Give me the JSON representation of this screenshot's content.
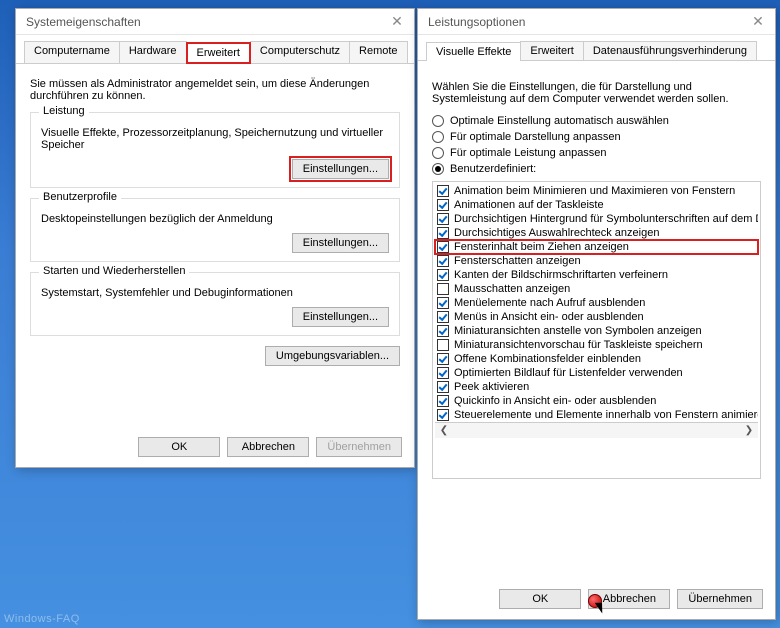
{
  "left": {
    "title": "Systemeigenschaften",
    "tabs": [
      "Computername",
      "Hardware",
      "Erweitert",
      "Computerschutz",
      "Remote"
    ],
    "active_tab": 2,
    "hint": "Sie müssen als Administrator angemeldet sein, um diese Änderungen durchführen zu können.",
    "groups": {
      "leistung": {
        "title": "Leistung",
        "desc": "Visuelle Effekte, Prozessorzeitplanung, Speichernutzung und virtueller Speicher",
        "btn": "Einstellungen..."
      },
      "profile": {
        "title": "Benutzerprofile",
        "desc": "Desktopeinstellungen bezüglich der Anmeldung",
        "btn": "Einstellungen..."
      },
      "start": {
        "title": "Starten und Wiederherstellen",
        "desc": "Systemstart, Systemfehler und Debuginformationen",
        "btn": "Einstellungen..."
      }
    },
    "envvars_btn": "Umgebungsvariablen...",
    "buttons": {
      "ok": "OK",
      "cancel": "Abbrechen",
      "apply": "Übernehmen"
    }
  },
  "right": {
    "title": "Leistungsoptionen",
    "tabs": [
      "Visuelle Effekte",
      "Erweitert",
      "Datenausführungsverhinderung"
    ],
    "active_tab": 0,
    "instr": "Wählen Sie die Einstellungen, die für Darstellung und Systemleistung auf dem Computer verwendet werden sollen.",
    "radios": [
      {
        "label": "Optimale Einstellung automatisch auswählen",
        "selected": false
      },
      {
        "label": "Für optimale Darstellung anpassen",
        "selected": false
      },
      {
        "label": "Für optimale Leistung anpassen",
        "selected": false
      },
      {
        "label": "Benutzerdefiniert:",
        "selected": true
      }
    ],
    "checks": [
      {
        "label": "Animation beim Minimieren und Maximieren von Fenstern",
        "checked": true
      },
      {
        "label": "Animationen auf der Taskleiste",
        "checked": true
      },
      {
        "label": "Durchsichtigen Hintergrund für Symbolunterschriften auf dem D",
        "checked": true
      },
      {
        "label": "Durchsichtiges Auswahlrechteck anzeigen",
        "checked": true
      },
      {
        "label": "Fensterinhalt beim Ziehen anzeigen",
        "checked": true,
        "highlight": true
      },
      {
        "label": "Fensterschatten anzeigen",
        "checked": true
      },
      {
        "label": "Kanten der Bildschirmschriftarten verfeinern",
        "checked": true
      },
      {
        "label": "Mausschatten anzeigen",
        "checked": false
      },
      {
        "label": "Menüelemente nach Aufruf ausblenden",
        "checked": true
      },
      {
        "label": "Menüs in Ansicht ein- oder ausblenden",
        "checked": true
      },
      {
        "label": "Miniaturansichten anstelle von Symbolen anzeigen",
        "checked": true
      },
      {
        "label": "Miniaturansichtenvorschau für Taskleiste speichern",
        "checked": false
      },
      {
        "label": "Offene Kombinationsfelder einblenden",
        "checked": true
      },
      {
        "label": "Optimierten Bildlauf für Listenfelder verwenden",
        "checked": true
      },
      {
        "label": "Peek aktivieren",
        "checked": true
      },
      {
        "label": "Quickinfo in Ansicht ein- oder ausblenden",
        "checked": true
      },
      {
        "label": "Steuerelemente und Elemente innerhalb von Fenstern animieren",
        "checked": true
      }
    ],
    "buttons": {
      "ok": "OK",
      "cancel": "Abbrechen",
      "apply": "Übernehmen"
    }
  },
  "watermark": "Windows-FAQ"
}
